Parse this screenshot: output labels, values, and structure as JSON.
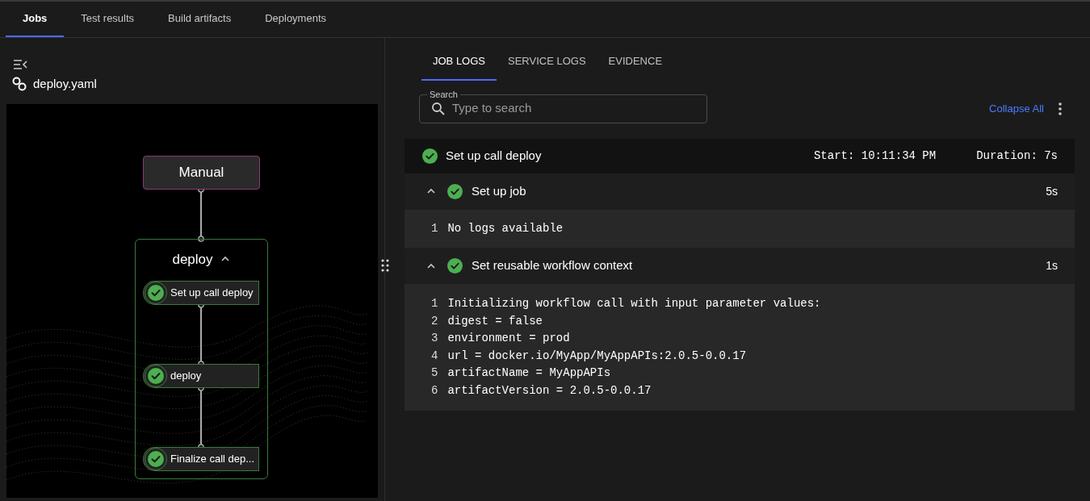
{
  "tabs": [
    {
      "label": "Jobs",
      "selected": true
    },
    {
      "label": "Test results",
      "selected": false
    },
    {
      "label": "Build artifacts",
      "selected": false
    },
    {
      "label": "Deployments",
      "selected": false
    }
  ],
  "sidebar": {
    "file_name": "deploy.yaml"
  },
  "diagram": {
    "trigger": "Manual",
    "group": {
      "title": "deploy",
      "expanded": true,
      "steps": [
        {
          "label": "Set up call deploy",
          "passed": true
        },
        {
          "label": "deploy",
          "passed": true
        },
        {
          "label": "Finalize call dep...",
          "passed": true
        }
      ]
    }
  },
  "log_tabs": [
    {
      "label": "JOB LOGS",
      "selected": true
    },
    {
      "label": "SERVICE LOGS",
      "selected": false
    },
    {
      "label": "EVIDENCE",
      "selected": false
    }
  ],
  "search": {
    "label": "Search",
    "placeholder": "Type to search"
  },
  "collapse_all": "Collapse All",
  "job": {
    "title": "Set up call deploy",
    "passed": true,
    "start": "Start: 10:11:34 PM",
    "duration": "Duration: 7s"
  },
  "steps": [
    {
      "title": "Set up job",
      "duration": "5s",
      "passed": true,
      "expanded": true,
      "lines": [
        {
          "number": "1",
          "text": "No logs available"
        }
      ]
    },
    {
      "title": "Set reusable workflow context",
      "duration": "1s",
      "passed": true,
      "expanded": true,
      "lines": [
        {
          "number": "1",
          "text": "Initializing workflow call with input parameter values:"
        },
        {
          "number": "2",
          "text": "digest = false"
        },
        {
          "number": "3",
          "text": "environment = prod"
        },
        {
          "number": "4",
          "text": "url = docker.io/MyApp/MyAppAPIs:2.0.5-0.0.17"
        },
        {
          "number": "5",
          "text": "artifactName = MyAppAPIs"
        },
        {
          "number": "6",
          "text": "artifactVersion = 2.0.5-0.0.17"
        }
      ]
    }
  ]
}
